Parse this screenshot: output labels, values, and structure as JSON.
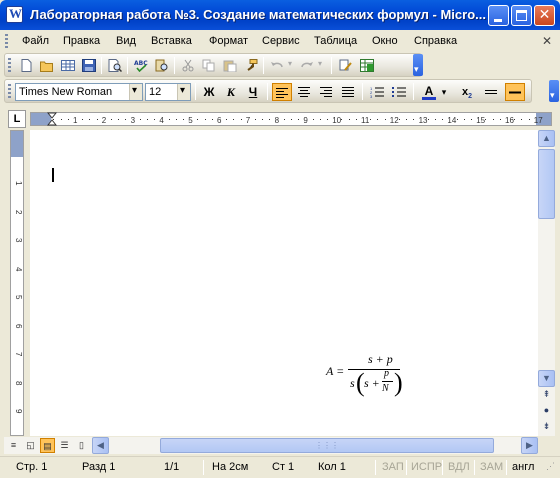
{
  "window": {
    "title": "Лабораторная работа №3. Создание математических формул - Micro..."
  },
  "menu": {
    "items": [
      "Файл",
      "Правка",
      "Вид",
      "Вставка",
      "Формат",
      "Сервис",
      "Таблица",
      "Окно",
      "Справка"
    ]
  },
  "standard_toolbar": {
    "icons": [
      "new-document-icon",
      "open-icon",
      "table-icon",
      "save-icon",
      "print-preview-icon",
      "spelling-icon",
      "research-icon",
      "cut-icon",
      "copy-icon",
      "paste-icon",
      "format-painter-icon",
      "undo-icon",
      "redo-icon",
      "insert-hyperlink-icon",
      "excel-icon"
    ]
  },
  "formatting_toolbar": {
    "font_name": "Times New Roman",
    "font_size": "12",
    "bold_label": "Ж",
    "italic_label": "К",
    "underline_label": "Ч"
  },
  "ruler": {
    "numbers": [
      "1",
      "2",
      "3",
      "4",
      "5",
      "6",
      "7",
      "8",
      "9",
      "10",
      "11",
      "12",
      "13",
      "14",
      "15",
      "16",
      "17"
    ],
    "vertical_numbers": [
      "1",
      "2",
      "3",
      "4",
      "5",
      "6",
      "7",
      "8",
      "9"
    ],
    "corner_label": "L"
  },
  "document": {
    "formula": {
      "lhs": "A =",
      "numerator": "s + p",
      "denominator_s": "s",
      "denominator_inner": "s +",
      "inner_num": "p",
      "inner_den": "N"
    }
  },
  "status_bar": {
    "page": "Стр.  1",
    "section": "Разд  1",
    "page_of": "1/1",
    "position": "На  2см",
    "line": "Ст  1",
    "column": "Кол  1",
    "rec": "ЗАП",
    "trk": "ИСПР",
    "ext": "ВДЛ",
    "ovr": "ЗАМ",
    "language": "англ"
  },
  "colors": {
    "title_bar": "#0046d5",
    "active_button": "#ffc35a",
    "font_color_underline": "#1f3cc7"
  }
}
